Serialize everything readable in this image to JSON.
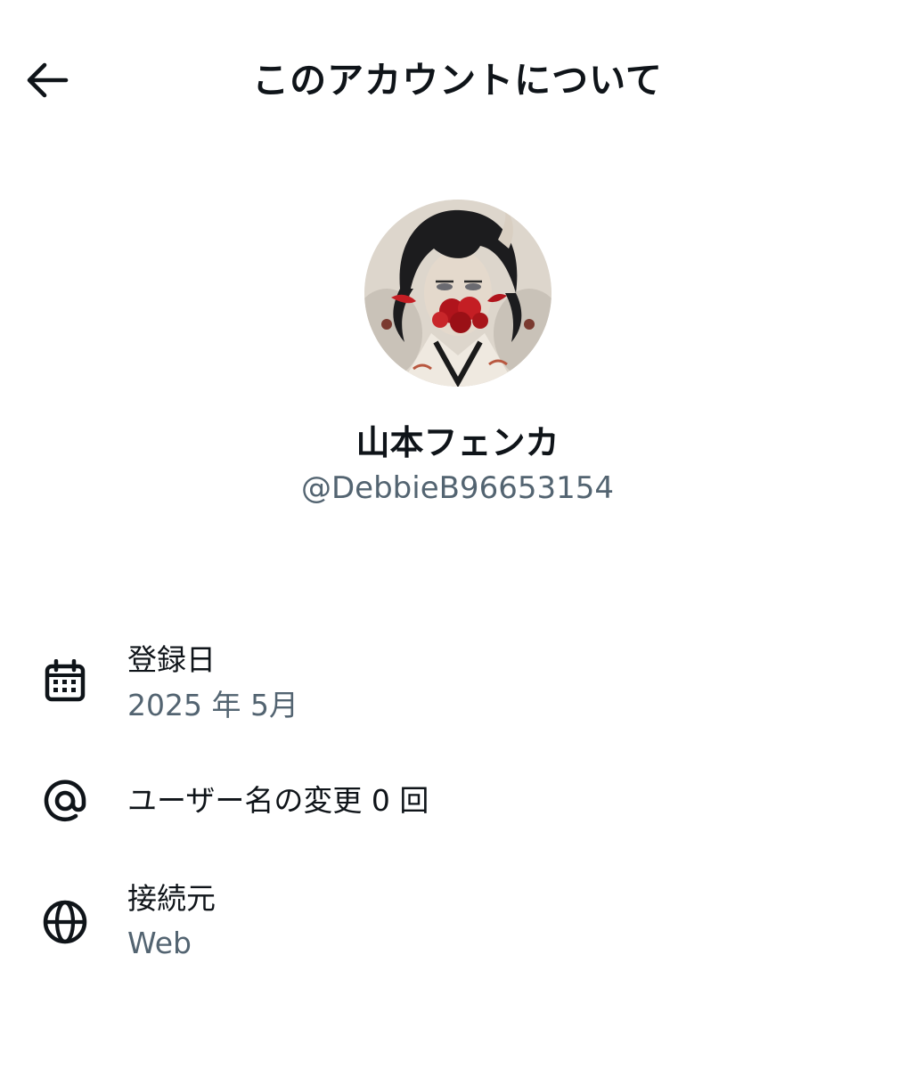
{
  "header": {
    "title": "このアカウントについて",
    "back_icon": "arrow-left-icon"
  },
  "profile": {
    "display_name": "山本フェンカ",
    "handle": "@DebbieB96653154",
    "avatar": "avatar-image"
  },
  "info": {
    "joined": {
      "icon": "calendar-icon",
      "label": "登録日",
      "value": "2025 年 5月"
    },
    "username_changes": {
      "icon": "at-sign-icon",
      "label": "ユーザー名の変更 0 回"
    },
    "connected_via": {
      "icon": "globe-icon",
      "label": "接続元",
      "value": "Web"
    }
  },
  "colors": {
    "text_primary": "#0f1419",
    "text_secondary": "#536471",
    "background": "#ffffff"
  }
}
